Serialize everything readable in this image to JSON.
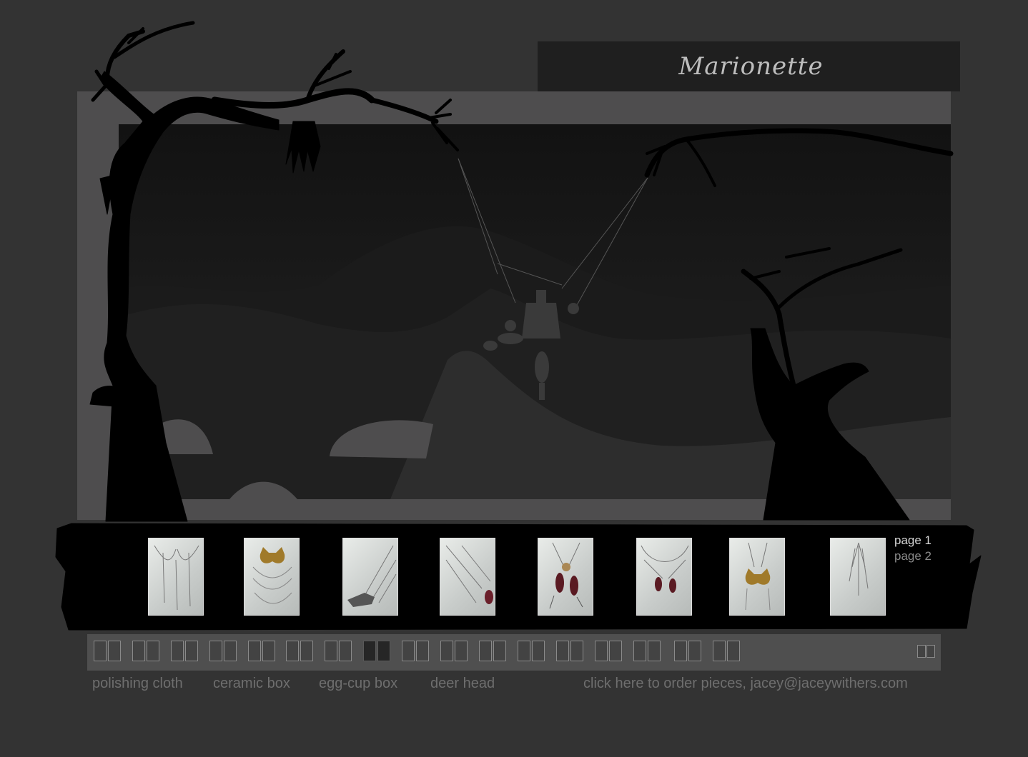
{
  "header": {
    "title": "Marionette"
  },
  "gallery": {
    "thumbnails": [
      {
        "name": "thumb-1"
      },
      {
        "name": "thumb-2"
      },
      {
        "name": "thumb-3"
      },
      {
        "name": "thumb-4"
      },
      {
        "name": "thumb-5"
      },
      {
        "name": "thumb-6"
      },
      {
        "name": "thumb-7"
      },
      {
        "name": "thumb-8"
      }
    ],
    "pages": [
      "page 1",
      "page 2"
    ],
    "current_page": 1
  },
  "navigation": {
    "book_icon_count": 17,
    "active_book_index": 7
  },
  "footer": {
    "links": [
      "polishing cloth",
      "ceramic box",
      "egg-cup box",
      "deer head"
    ],
    "order_text": "click here to order pieces, jacey@jaceywithers.com"
  },
  "colors": {
    "page_background": "#333333",
    "frame": "#4e4d4e",
    "title_bar": "#1f1f1f",
    "silhouette": "#000000",
    "footer_text": "#6e6e6e"
  }
}
